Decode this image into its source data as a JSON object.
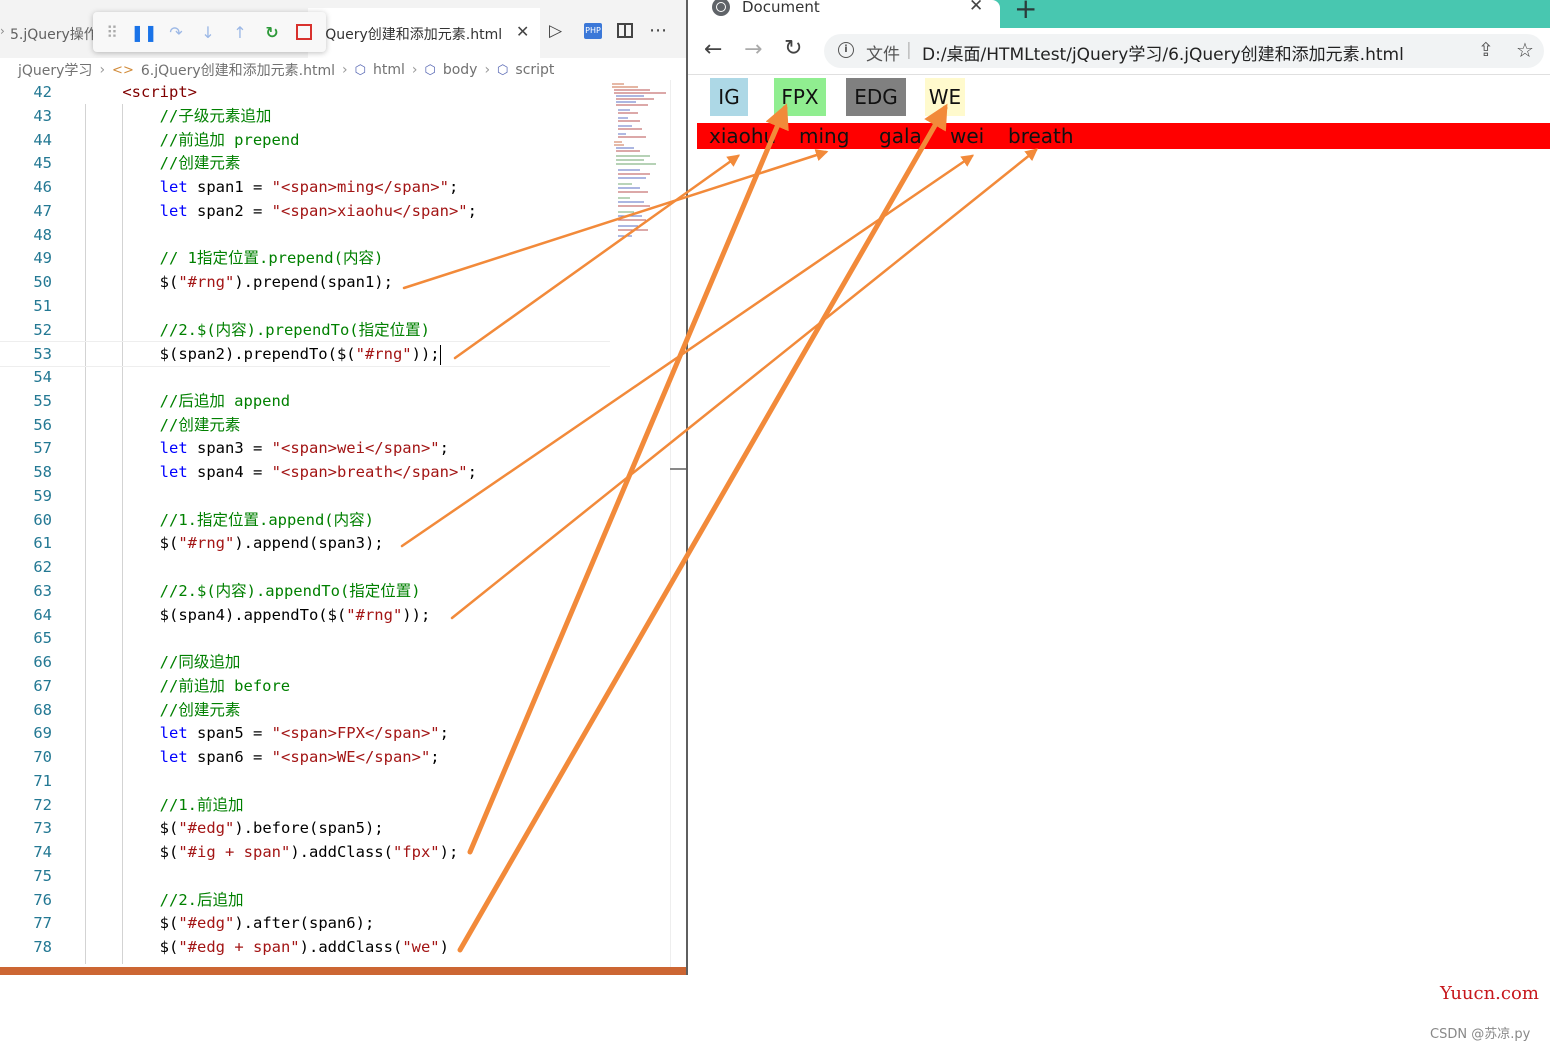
{
  "editor": {
    "tabs": {
      "left_tab": "5.jQuery操作",
      "active_tab": "6.jQuery创建和添加元素.html"
    },
    "breadcrumb": {
      "folder": "jQuery学习",
      "file": "6.jQuery创建和添加元素.html",
      "html": "html",
      "body": "body",
      "script": "script"
    },
    "lines": [
      {
        "n": "42",
        "parts": [
          {
            "t": "    ",
            "c": ""
          },
          {
            "t": "<script>",
            "c": "c-tag"
          }
        ]
      },
      {
        "n": "43",
        "parts": [
          {
            "t": "        ",
            "c": ""
          },
          {
            "t": "//子级元素追加",
            "c": "c-cmt"
          }
        ]
      },
      {
        "n": "44",
        "parts": [
          {
            "t": "        ",
            "c": ""
          },
          {
            "t": "//前追加 prepend",
            "c": "c-cmt"
          }
        ]
      },
      {
        "n": "45",
        "parts": [
          {
            "t": "        ",
            "c": ""
          },
          {
            "t": "//创建元素",
            "c": "c-cmt"
          }
        ]
      },
      {
        "n": "46",
        "parts": [
          {
            "t": "        ",
            "c": ""
          },
          {
            "t": "let",
            "c": "c-kw"
          },
          {
            "t": " span1 = ",
            "c": ""
          },
          {
            "t": "\"<span>ming</span>\"",
            "c": "c-str"
          },
          {
            "t": ";",
            "c": ""
          }
        ]
      },
      {
        "n": "47",
        "parts": [
          {
            "t": "        ",
            "c": ""
          },
          {
            "t": "let",
            "c": "c-kw"
          },
          {
            "t": " span2 = ",
            "c": ""
          },
          {
            "t": "\"<span>xiaohu</span>\"",
            "c": "c-str"
          },
          {
            "t": ";",
            "c": ""
          }
        ]
      },
      {
        "n": "48",
        "parts": []
      },
      {
        "n": "49",
        "parts": [
          {
            "t": "        ",
            "c": ""
          },
          {
            "t": "// 1指定位置.prepend(内容)",
            "c": "c-cmt"
          }
        ]
      },
      {
        "n": "50",
        "parts": [
          {
            "t": "        ",
            "c": ""
          },
          {
            "t": "$(",
            "c": ""
          },
          {
            "t": "\"#rng\"",
            "c": "c-str"
          },
          {
            "t": ").prepend(span1);",
            "c": ""
          }
        ]
      },
      {
        "n": "51",
        "parts": []
      },
      {
        "n": "52",
        "parts": [
          {
            "t": "        ",
            "c": ""
          },
          {
            "t": "//2.$(内容).prependTo(指定位置)",
            "c": "c-cmt"
          }
        ]
      },
      {
        "n": "53",
        "parts": [
          {
            "t": "        ",
            "c": ""
          },
          {
            "t": "$(span2).prependTo($(",
            "c": ""
          },
          {
            "t": "\"#rng\"",
            "c": "c-str"
          },
          {
            "t": "));",
            "c": ""
          }
        ]
      },
      {
        "n": "54",
        "parts": []
      },
      {
        "n": "55",
        "parts": [
          {
            "t": "        ",
            "c": ""
          },
          {
            "t": "//后追加 append",
            "c": "c-cmt"
          }
        ]
      },
      {
        "n": "56",
        "parts": [
          {
            "t": "        ",
            "c": ""
          },
          {
            "t": "//创建元素",
            "c": "c-cmt"
          }
        ]
      },
      {
        "n": "57",
        "parts": [
          {
            "t": "        ",
            "c": ""
          },
          {
            "t": "let",
            "c": "c-kw"
          },
          {
            "t": " span3 = ",
            "c": ""
          },
          {
            "t": "\"<span>wei</span>\"",
            "c": "c-str"
          },
          {
            "t": ";",
            "c": ""
          }
        ]
      },
      {
        "n": "58",
        "parts": [
          {
            "t": "        ",
            "c": ""
          },
          {
            "t": "let",
            "c": "c-kw"
          },
          {
            "t": " span4 = ",
            "c": ""
          },
          {
            "t": "\"<span>breath</span>\"",
            "c": "c-str"
          },
          {
            "t": ";",
            "c": ""
          }
        ]
      },
      {
        "n": "59",
        "parts": []
      },
      {
        "n": "60",
        "parts": [
          {
            "t": "        ",
            "c": ""
          },
          {
            "t": "//1.指定位置.append(内容)",
            "c": "c-cmt"
          }
        ]
      },
      {
        "n": "61",
        "parts": [
          {
            "t": "        ",
            "c": ""
          },
          {
            "t": "$(",
            "c": ""
          },
          {
            "t": "\"#rng\"",
            "c": "c-str"
          },
          {
            "t": ").append(span3);",
            "c": ""
          }
        ]
      },
      {
        "n": "62",
        "parts": []
      },
      {
        "n": "63",
        "parts": [
          {
            "t": "        ",
            "c": ""
          },
          {
            "t": "//2.$(内容).appendTo(指定位置)",
            "c": "c-cmt"
          }
        ]
      },
      {
        "n": "64",
        "parts": [
          {
            "t": "        ",
            "c": ""
          },
          {
            "t": "$(span4).appendTo($(",
            "c": ""
          },
          {
            "t": "\"#rng\"",
            "c": "c-str"
          },
          {
            "t": "));",
            "c": ""
          }
        ]
      },
      {
        "n": "65",
        "parts": []
      },
      {
        "n": "66",
        "parts": [
          {
            "t": "        ",
            "c": ""
          },
          {
            "t": "//同级追加",
            "c": "c-cmt"
          }
        ]
      },
      {
        "n": "67",
        "parts": [
          {
            "t": "        ",
            "c": ""
          },
          {
            "t": "//前追加 before",
            "c": "c-cmt"
          }
        ]
      },
      {
        "n": "68",
        "parts": [
          {
            "t": "        ",
            "c": ""
          },
          {
            "t": "//创建元素",
            "c": "c-cmt"
          }
        ]
      },
      {
        "n": "69",
        "parts": [
          {
            "t": "        ",
            "c": ""
          },
          {
            "t": "let",
            "c": "c-kw"
          },
          {
            "t": " span5 = ",
            "c": ""
          },
          {
            "t": "\"<span>FPX</span>\"",
            "c": "c-str"
          },
          {
            "t": ";",
            "c": ""
          }
        ]
      },
      {
        "n": "70",
        "parts": [
          {
            "t": "        ",
            "c": ""
          },
          {
            "t": "let",
            "c": "c-kw"
          },
          {
            "t": " span6 = ",
            "c": ""
          },
          {
            "t": "\"<span>WE</span>\"",
            "c": "c-str"
          },
          {
            "t": ";",
            "c": ""
          }
        ]
      },
      {
        "n": "71",
        "parts": []
      },
      {
        "n": "72",
        "parts": [
          {
            "t": "        ",
            "c": ""
          },
          {
            "t": "//1.前追加",
            "c": "c-cmt"
          }
        ]
      },
      {
        "n": "73",
        "parts": [
          {
            "t": "        ",
            "c": ""
          },
          {
            "t": "$(",
            "c": ""
          },
          {
            "t": "\"#edg\"",
            "c": "c-str"
          },
          {
            "t": ").before(span5);",
            "c": ""
          }
        ]
      },
      {
        "n": "74",
        "parts": [
          {
            "t": "        ",
            "c": ""
          },
          {
            "t": "$(",
            "c": ""
          },
          {
            "t": "\"#ig + span\"",
            "c": "c-str"
          },
          {
            "t": ").addClass(",
            "c": ""
          },
          {
            "t": "\"fpx\"",
            "c": "c-str"
          },
          {
            "t": ");",
            "c": ""
          }
        ]
      },
      {
        "n": "75",
        "parts": []
      },
      {
        "n": "76",
        "parts": [
          {
            "t": "        ",
            "c": ""
          },
          {
            "t": "//2.后追加",
            "c": "c-cmt"
          }
        ]
      },
      {
        "n": "77",
        "parts": [
          {
            "t": "        ",
            "c": ""
          },
          {
            "t": "$(",
            "c": ""
          },
          {
            "t": "\"#edg\"",
            "c": "c-str"
          },
          {
            "t": ").after(span6);",
            "c": ""
          }
        ]
      },
      {
        "n": "78",
        "parts": [
          {
            "t": "        ",
            "c": ""
          },
          {
            "t": "$(",
            "c": ""
          },
          {
            "t": "\"#edg + span\"",
            "c": "c-str"
          },
          {
            "t": ").addClass(",
            "c": ""
          },
          {
            "t": "\"we\"",
            "c": "c-str"
          },
          {
            "t": ")",
            "c": ""
          }
        ]
      }
    ]
  },
  "browser": {
    "tab_title": "Document",
    "address_label": "文件",
    "url": "D:/桌面/HTMLtest/jQuery学习/6.jQuery创建和添加元素.html",
    "teams": [
      {
        "label": "IG",
        "bg": "#add8e6"
      },
      {
        "label": "FPX",
        "bg": "#90ee90"
      },
      {
        "label": "EDG",
        "bg": "#808080"
      },
      {
        "label": "WE",
        "bg": "#fffacd"
      }
    ],
    "rng_spans": [
      "xiaohu",
      "ming",
      "gala",
      "wei",
      "breath"
    ],
    "rng_color": "#ff0000"
  },
  "watermark": {
    "site": "Yuucn.com",
    "csdn": "CSDN @苏凉.py"
  },
  "annotation_color": "#f28a3a"
}
